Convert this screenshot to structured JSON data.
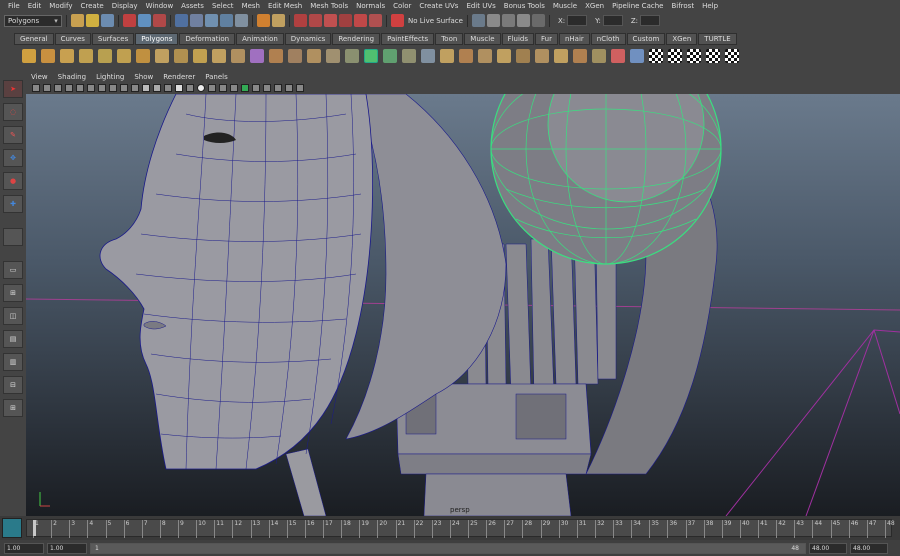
{
  "menu": [
    "File",
    "Edit",
    "Modify",
    "Create",
    "Display",
    "Window",
    "Assets",
    "Select",
    "Mesh",
    "Edit Mesh",
    "Mesh Tools",
    "Normals",
    "Color",
    "Create UVs",
    "Edit UVs",
    "Bonus Tools",
    "Muscle",
    "XGen",
    "Pipeline Cache",
    "Bifrost",
    "Help"
  ],
  "status": {
    "mode": "Polygons",
    "live_surface": "No Live Surface",
    "x_label": "X:",
    "y_label": "Y:",
    "z_label": "Z:"
  },
  "shelf_tabs": [
    "General",
    "Curves",
    "Surfaces",
    "Polygons",
    "Deformation",
    "Animation",
    "Dynamics",
    "Rendering",
    "PaintEffects",
    "Toon",
    "Muscle",
    "Fluids",
    "Fur",
    "nHair",
    "nCloth",
    "Custom",
    "XGen",
    "TURTLE"
  ],
  "active_shelf_tab": "Polygons",
  "panel_menu": [
    "View",
    "Shading",
    "Lighting",
    "Show",
    "Renderer",
    "Panels"
  ],
  "viewport_label": "persp",
  "timeline": {
    "ticks": [
      "1",
      "2",
      "3",
      "4",
      "5",
      "6",
      "7",
      "8",
      "9",
      "10",
      "11",
      "12",
      "13",
      "14",
      "15",
      "16",
      "17",
      "18",
      "19",
      "20",
      "21",
      "22",
      "23",
      "24",
      "25",
      "26",
      "27",
      "28",
      "29",
      "30",
      "31",
      "32",
      "33",
      "34",
      "35",
      "36",
      "37",
      "38",
      "39",
      "40",
      "41",
      "42",
      "43",
      "44",
      "45",
      "46",
      "47",
      "48"
    ],
    "current": "1"
  },
  "range": {
    "start_time": "1.00",
    "start_range": "1.00",
    "range_start_inner": "1",
    "range_end_inner": "48",
    "end_range": "48.00",
    "end_time": "48.00"
  },
  "colors": {
    "selected_wire": "#39e080",
    "wire": "#1a1a8a",
    "accent": "#5d6872"
  }
}
